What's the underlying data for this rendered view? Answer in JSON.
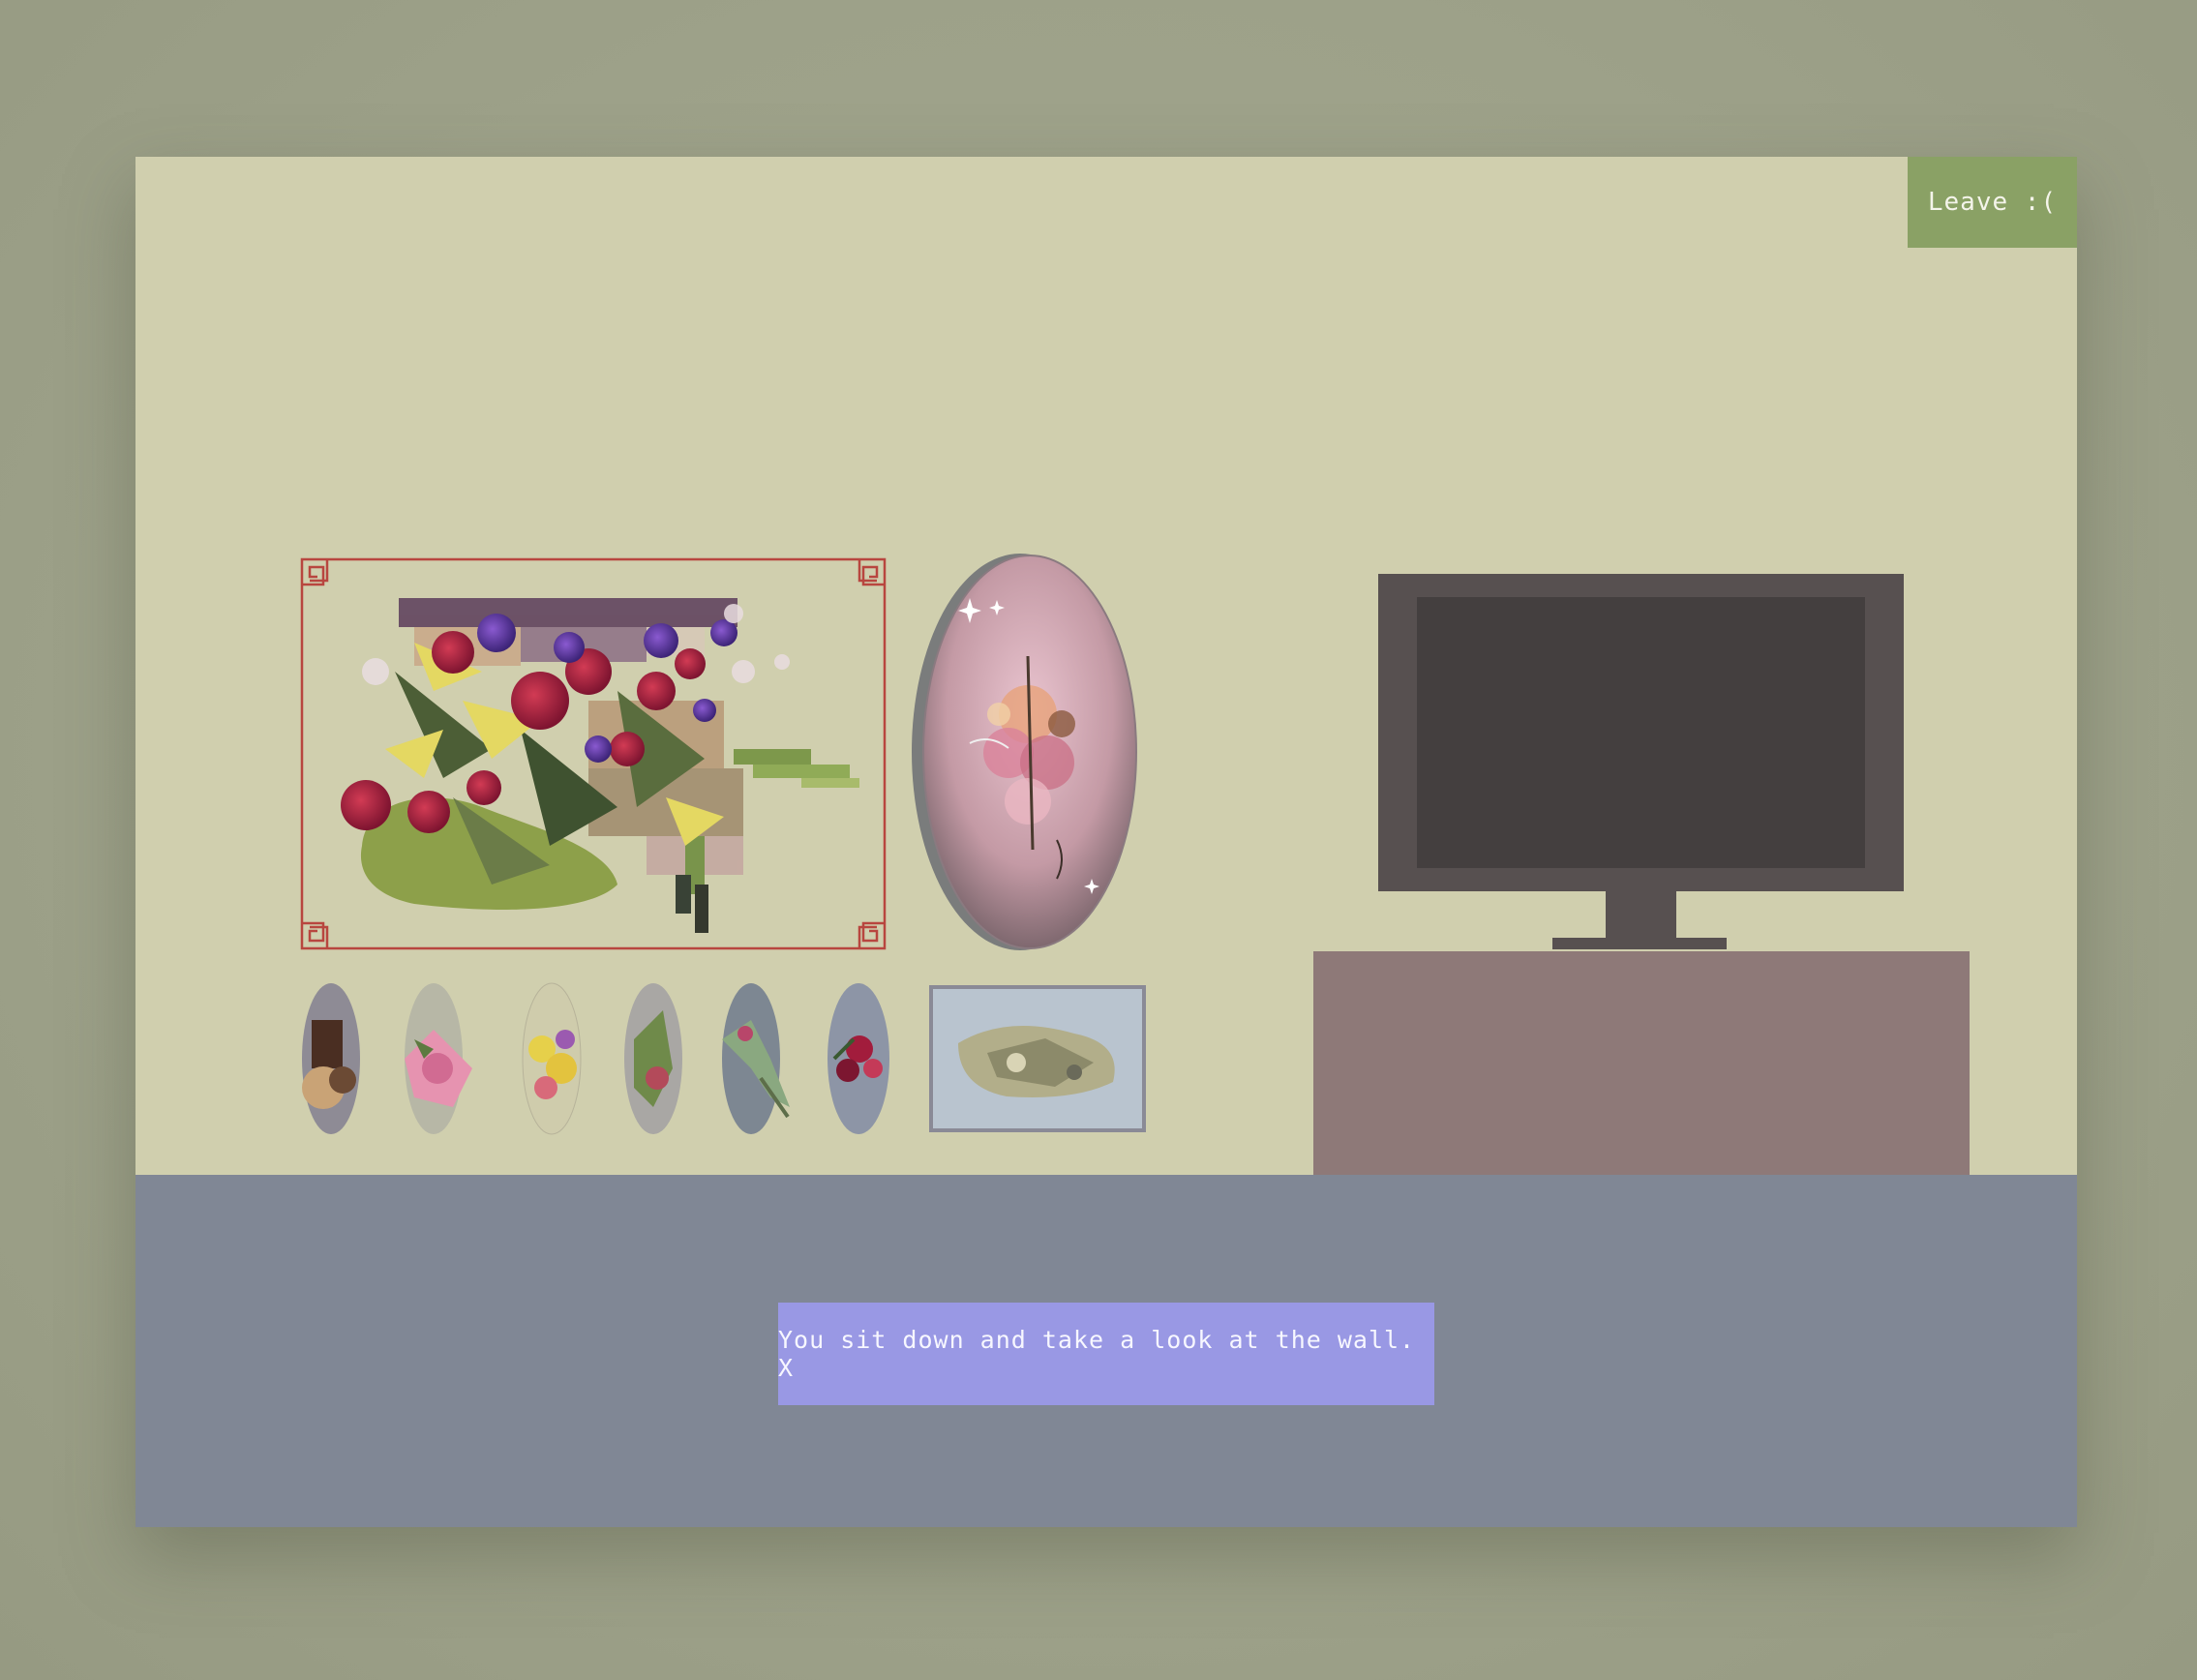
{
  "header": {
    "leave_label": "Leave :("
  },
  "dialog": {
    "text": "You sit down and take a look at the wall. X"
  },
  "colors": {
    "background": "#a0a58c",
    "wall": "#d0cfae",
    "floor": "#808795",
    "leave_button": "#8aa165",
    "dialog": "#9998e4",
    "frame_border": "#b8463f",
    "tv_body": "#575050",
    "tv_screen": "#443f3f",
    "cabinet": "#8e7978"
  },
  "wall_art": {
    "main_painting": "flower-bouquet-painting",
    "oval_painting": "pink-flower-oval-painting",
    "mini_ovals": [
      "brown-flower",
      "pink-flower",
      "yellow-flower",
      "green-flower",
      "green-sprig",
      "red-flower"
    ],
    "mini_rect": "grey-flower-painting"
  }
}
